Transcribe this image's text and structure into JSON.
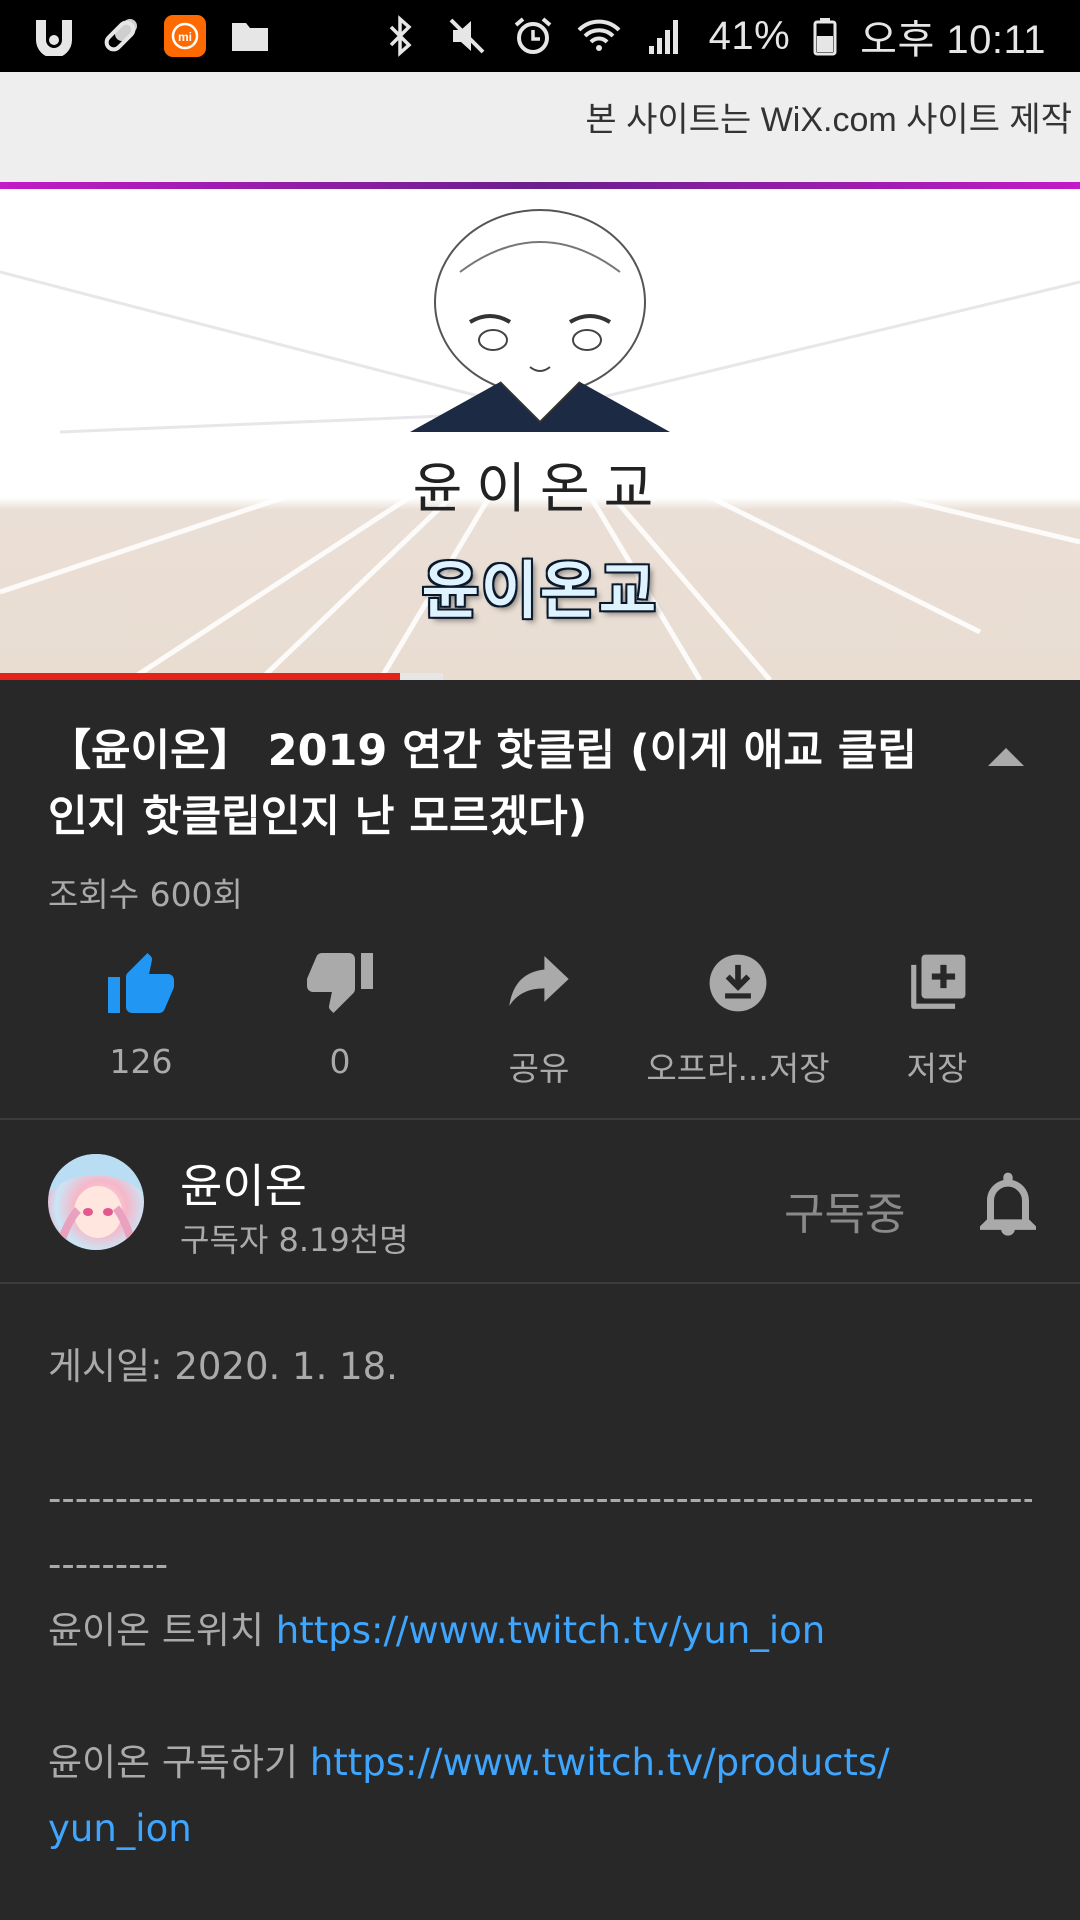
{
  "status_bar": {
    "battery": "41%",
    "time": "오후 10:11",
    "icons_left": [
      "u-app-icon",
      "pill-icon",
      "mi-icon",
      "folder-icon"
    ],
    "icons_right": [
      "bluetooth-icon",
      "mute-icon",
      "alarm-icon",
      "wifi-icon",
      "signal-icon",
      "battery-icon"
    ]
  },
  "video": {
    "top_banner": "본 사이트는 WiX.com 사이트 제작",
    "art_caption": "윤이온교",
    "caption": "윤이온교",
    "progress": 0.37,
    "buffered": 0.41
  },
  "title": "【윤이온】 2019 연간 핫클립 (이게 애교 클립인지 핫클립인지 난 모르겠다)",
  "views": "조회수 600회",
  "actions": [
    {
      "label": "126",
      "icon": "thumbs-up-icon",
      "active": true
    },
    {
      "label": "0",
      "icon": "thumbs-down-icon"
    },
    {
      "label": "공유",
      "icon": "share-icon"
    },
    {
      "label": "오프라...저장",
      "icon": "download-icon"
    },
    {
      "label": "저장",
      "icon": "add-to-playlist-icon"
    }
  ],
  "channel": {
    "name": "윤이온",
    "subscribers": "구독자 8.19천명",
    "subscribe_state": "구독중"
  },
  "description": {
    "published": "게시일: 2020. 1. 18.",
    "separator_line1": "---------------------------------------------------------------------------------",
    "separator_line2": "---------",
    "twitch_label": "윤이온 트위치 ",
    "twitch_url": "https://www.twitch.tv/yun_ion",
    "sub_label": "윤이온 구독하기 ",
    "sub_url_line1": "https://www.twitch.tv/products/",
    "sub_url_line2": "yun_ion"
  },
  "colors": {
    "background": "#282828",
    "accent_blue": "#3ea6ff",
    "like_blue": "#2196f3",
    "progress_red": "#e62117"
  }
}
